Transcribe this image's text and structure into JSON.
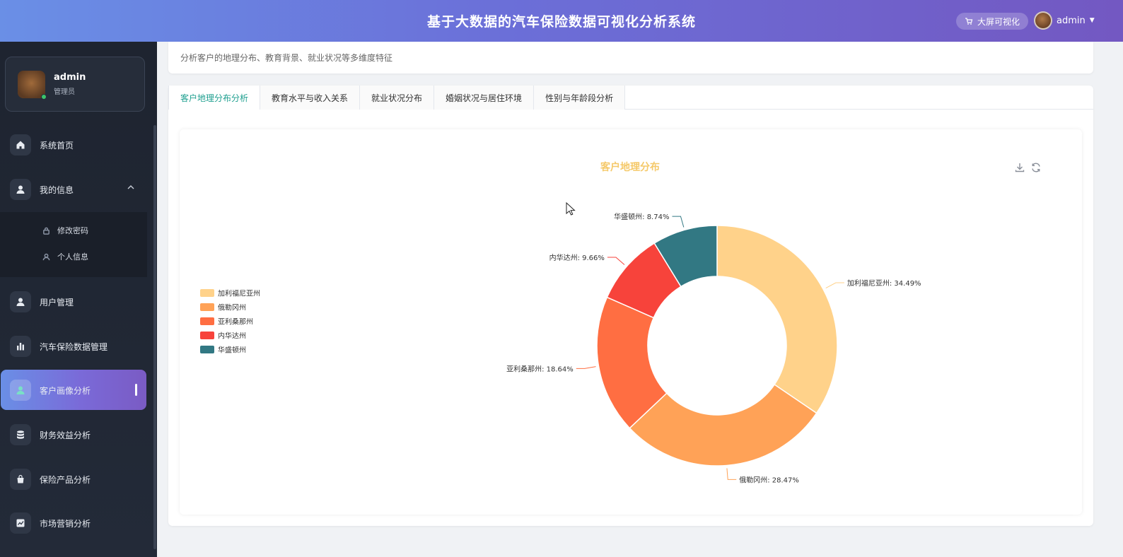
{
  "header": {
    "title": "基于大数据的汽车保险数据可视化分析系统",
    "bigscreen_label": "大屏可视化",
    "user": "admin"
  },
  "sidebar": {
    "user": {
      "name": "admin",
      "role": "管理员"
    },
    "items": [
      {
        "label": "系统首页"
      },
      {
        "label": "我的信息"
      },
      {
        "label": "用户管理"
      },
      {
        "label": "汽车保险数据管理"
      },
      {
        "label": "客户画像分析"
      },
      {
        "label": "财务效益分析"
      },
      {
        "label": "保险产品分析"
      },
      {
        "label": "市场营销分析"
      }
    ],
    "submenu": [
      {
        "label": "修改密码"
      },
      {
        "label": "个人信息"
      }
    ]
  },
  "description": "分析客户的地理分布、教育背景、就业状况等多维度特征",
  "tabs": [
    {
      "label": "客户地理分布分析"
    },
    {
      "label": "教育水平与收入关系"
    },
    {
      "label": "就业状况分布"
    },
    {
      "label": "婚姻状况与居住环境"
    },
    {
      "label": "性别与年龄段分析"
    }
  ],
  "chart_data": {
    "type": "pie",
    "title": "客户地理分布",
    "donut": true,
    "legend_position": "left",
    "series": [
      {
        "name": "加利福尼亚州",
        "value": 34.49,
        "label": "加利福尼亚州: 34.49%",
        "color": "#ffd28a"
      },
      {
        "name": "俄勒冈州",
        "value": 28.47,
        "label": "俄勒冈州: 28.47%",
        "color": "#ffa257"
      },
      {
        "name": "亚利桑那州",
        "value": 18.64,
        "label": "亚利桑那州: 18.64%",
        "color": "#ff6e42"
      },
      {
        "name": "内华达州",
        "value": 9.66,
        "label": "内华达州: 9.66%",
        "color": "#f7433b"
      },
      {
        "name": "华盛顿州",
        "value": 8.74,
        "label": "华盛顿州: 8.74%",
        "color": "#327883"
      }
    ]
  }
}
